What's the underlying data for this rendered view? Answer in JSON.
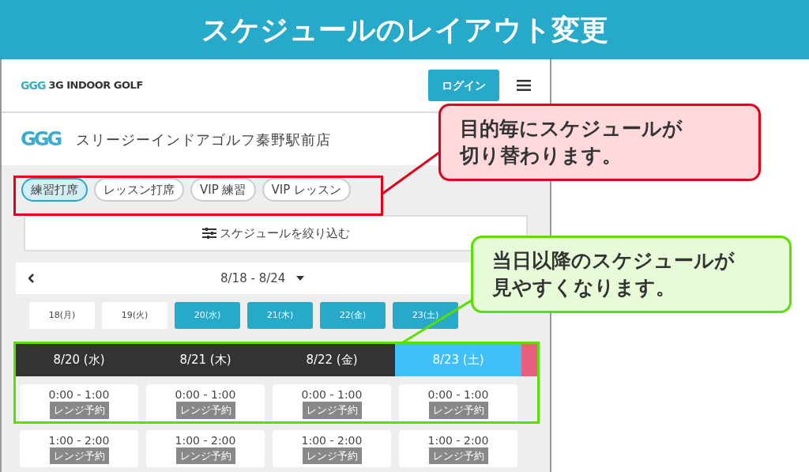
{
  "banner": {
    "title": "スケジュールのレイアウト変更"
  },
  "header": {
    "logo_mark": "GGG",
    "logo_text": "3G INDOOR GOLF",
    "login": "ログイン"
  },
  "shop": {
    "logo": "GGG",
    "name": "スリージーインドアゴルフ秦野駅前店"
  },
  "tabs": [
    {
      "label": "練習打席",
      "selected": true
    },
    {
      "label": "レッスン打席",
      "selected": false
    },
    {
      "label": "VIP 練習",
      "selected": false
    },
    {
      "label": "VIP レッスン",
      "selected": false
    }
  ],
  "filter": {
    "label": "スケジュールを絞り込む"
  },
  "week": {
    "range": "8/18 - 8/24"
  },
  "days": [
    {
      "label": "18(月)",
      "available": false
    },
    {
      "label": "19(火)",
      "available": false
    },
    {
      "label": "20(水)",
      "available": true
    },
    {
      "label": "21(木)",
      "available": true
    },
    {
      "label": "22(金)",
      "available": true
    },
    {
      "label": "23(土)",
      "available": true
    }
  ],
  "day_headers": [
    {
      "label": "8/20 (水)",
      "color": "#333333"
    },
    {
      "label": "8/21 (木)",
      "color": "#333333"
    },
    {
      "label": "8/22 (金)",
      "color": "#333333"
    },
    {
      "label": "8/23 (土)",
      "color": "#40c0f8"
    },
    {
      "color": "#ea5f80"
    }
  ],
  "slots": [
    [
      {
        "time": "0:00 - 1:00",
        "tag": "レンジ予約"
      },
      {
        "time": "0:00 - 1:00",
        "tag": "レンジ予約"
      },
      {
        "time": "0:00 - 1:00",
        "tag": "レンジ予約"
      },
      {
        "time": "0:00 - 1:00",
        "tag": "レンジ予約"
      }
    ],
    [
      {
        "time": "1:00 - 2:00",
        "tag": "レンジ予約"
      },
      {
        "time": "1:00 - 2:00",
        "tag": "レンジ予約"
      },
      {
        "time": "1:00 - 2:00",
        "tag": "レンジ予約"
      },
      {
        "time": "1:00 - 2:00",
        "tag": "レンジ予約"
      }
    ]
  ],
  "callouts": [
    {
      "kind": "alert",
      "text": "目的毎にスケジュールが切り替わります。"
    },
    {
      "kind": "info",
      "text": "当日以降のスケジュールが見やすくなります。"
    }
  ]
}
